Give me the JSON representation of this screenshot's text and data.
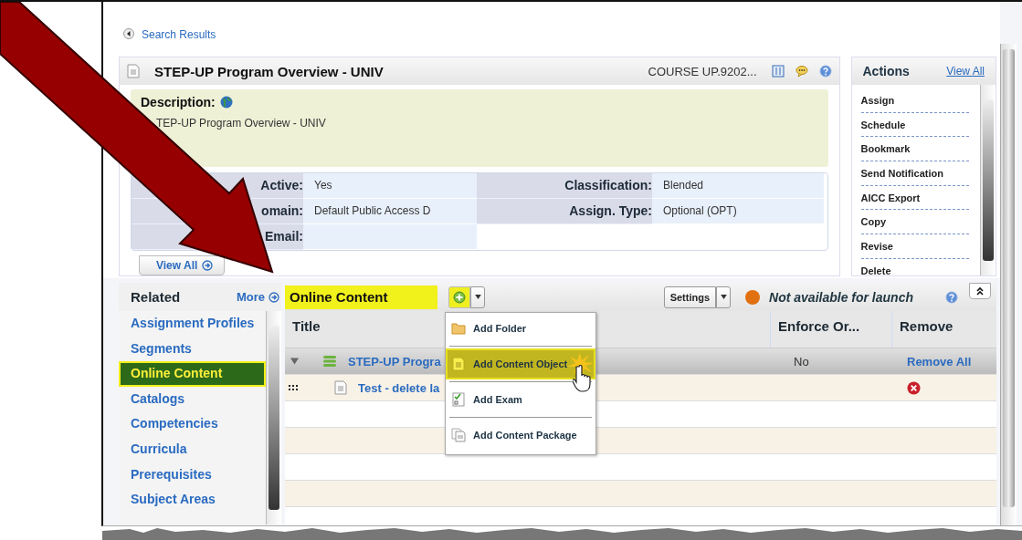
{
  "breadcrumb": {
    "label": "Search Results"
  },
  "course": {
    "title": "STEP-UP Program Overview - UNIV",
    "code": "COURSE UP.9202...",
    "description_label": "Description:",
    "description": "TEP-UP Program Overview - UNIV",
    "fields": [
      {
        "label": "Active:",
        "value": "Yes"
      },
      {
        "label": "Classification:",
        "value": "Blended"
      },
      {
        "label": "omain:",
        "value": "Default Public Access D"
      },
      {
        "label": "Assign. Type:",
        "value": "Optional (OPT)"
      },
      {
        "label": "Email:"
      }
    ],
    "view_all": "View All"
  },
  "actions": {
    "title": "Actions",
    "view_all": "View All",
    "items": [
      "Assign",
      "Schedule",
      "Bookmark",
      "Send Notification",
      "AICC Export",
      "Copy",
      "Revise",
      "Delete"
    ]
  },
  "related": {
    "title": "Related",
    "more": "More",
    "items": [
      {
        "label": "Assignment Profiles",
        "selected": false
      },
      {
        "label": "Segments",
        "selected": false
      },
      {
        "label": "Online Content",
        "selected": true
      },
      {
        "label": "Catalogs",
        "selected": false
      },
      {
        "label": "Competencies",
        "selected": false
      },
      {
        "label": "Curricula",
        "selected": false
      },
      {
        "label": "Prerequisites",
        "selected": false
      },
      {
        "label": "Subject Areas",
        "selected": false
      }
    ]
  },
  "content": {
    "title": "Online Content",
    "settings": "Settings",
    "status": "Not available for launch",
    "columns": [
      "Title",
      "Enforce Or...",
      "Remove"
    ],
    "rows": [
      {
        "kind": "group",
        "title": "STEP-UP Progra",
        "enforce": "No",
        "remove": "Remove All"
      },
      {
        "kind": "item",
        "title": "Test - delete la"
      }
    ]
  },
  "add_menu": {
    "items": [
      {
        "kind": "folder",
        "label": "Add Folder",
        "selected": false
      },
      {
        "kind": "object",
        "label": "Add Content Object",
        "selected": true
      },
      {
        "kind": "exam",
        "label": "Add Exam",
        "selected": false
      },
      {
        "kind": "package",
        "label": "Add Content Package",
        "selected": false
      }
    ]
  }
}
